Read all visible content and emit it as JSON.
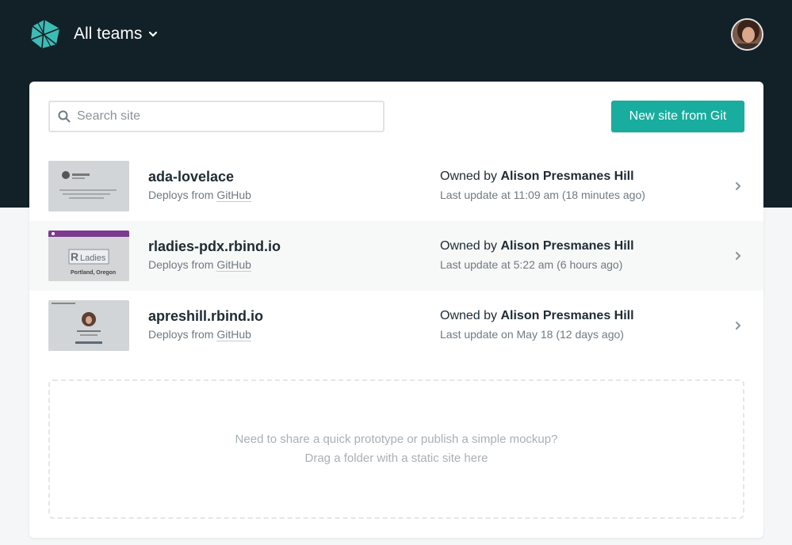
{
  "header": {
    "team_label": "All teams",
    "logo_icon": "netlify-logo-icon",
    "chevron_icon": "chevron-down-icon",
    "avatar_icon": "user-avatar"
  },
  "toolbar": {
    "search_placeholder": "Search site",
    "search_icon": "search-icon",
    "new_site_label": "New site from Git"
  },
  "sites": [
    {
      "name": "ada-lovelace",
      "deploy_prefix": "Deploys from ",
      "deploy_source": "GitHub",
      "owner_prefix": "Owned by ",
      "owner": "Alison Presmanes Hill",
      "updated": "Last update at 11:09 am (18 minutes ago)"
    },
    {
      "name": "rladies-pdx.rbind.io",
      "deploy_prefix": "Deploys from ",
      "deploy_source": "GitHub",
      "owner_prefix": "Owned by ",
      "owner": "Alison Presmanes Hill",
      "updated": "Last update at 5:22 am (6 hours ago)",
      "thumb_text": {
        "brand_r": "R",
        "brand_word": "Ladies",
        "city": "Portland, Oregon"
      }
    },
    {
      "name": "apreshill.rbind.io",
      "deploy_prefix": "Deploys from ",
      "deploy_source": "GitHub",
      "owner_prefix": "Owned by ",
      "owner": "Alison Presmanes Hill",
      "updated": "Last update on May 18 (12 days ago)"
    }
  ],
  "dropzone": {
    "line1": "Need to share a quick prototype or publish a simple mockup?",
    "line2": "Drag a folder with a static site here"
  },
  "colors": {
    "header_bg": "#122028",
    "accent": "#18ad9e",
    "page_bg": "#f4f6f7"
  }
}
